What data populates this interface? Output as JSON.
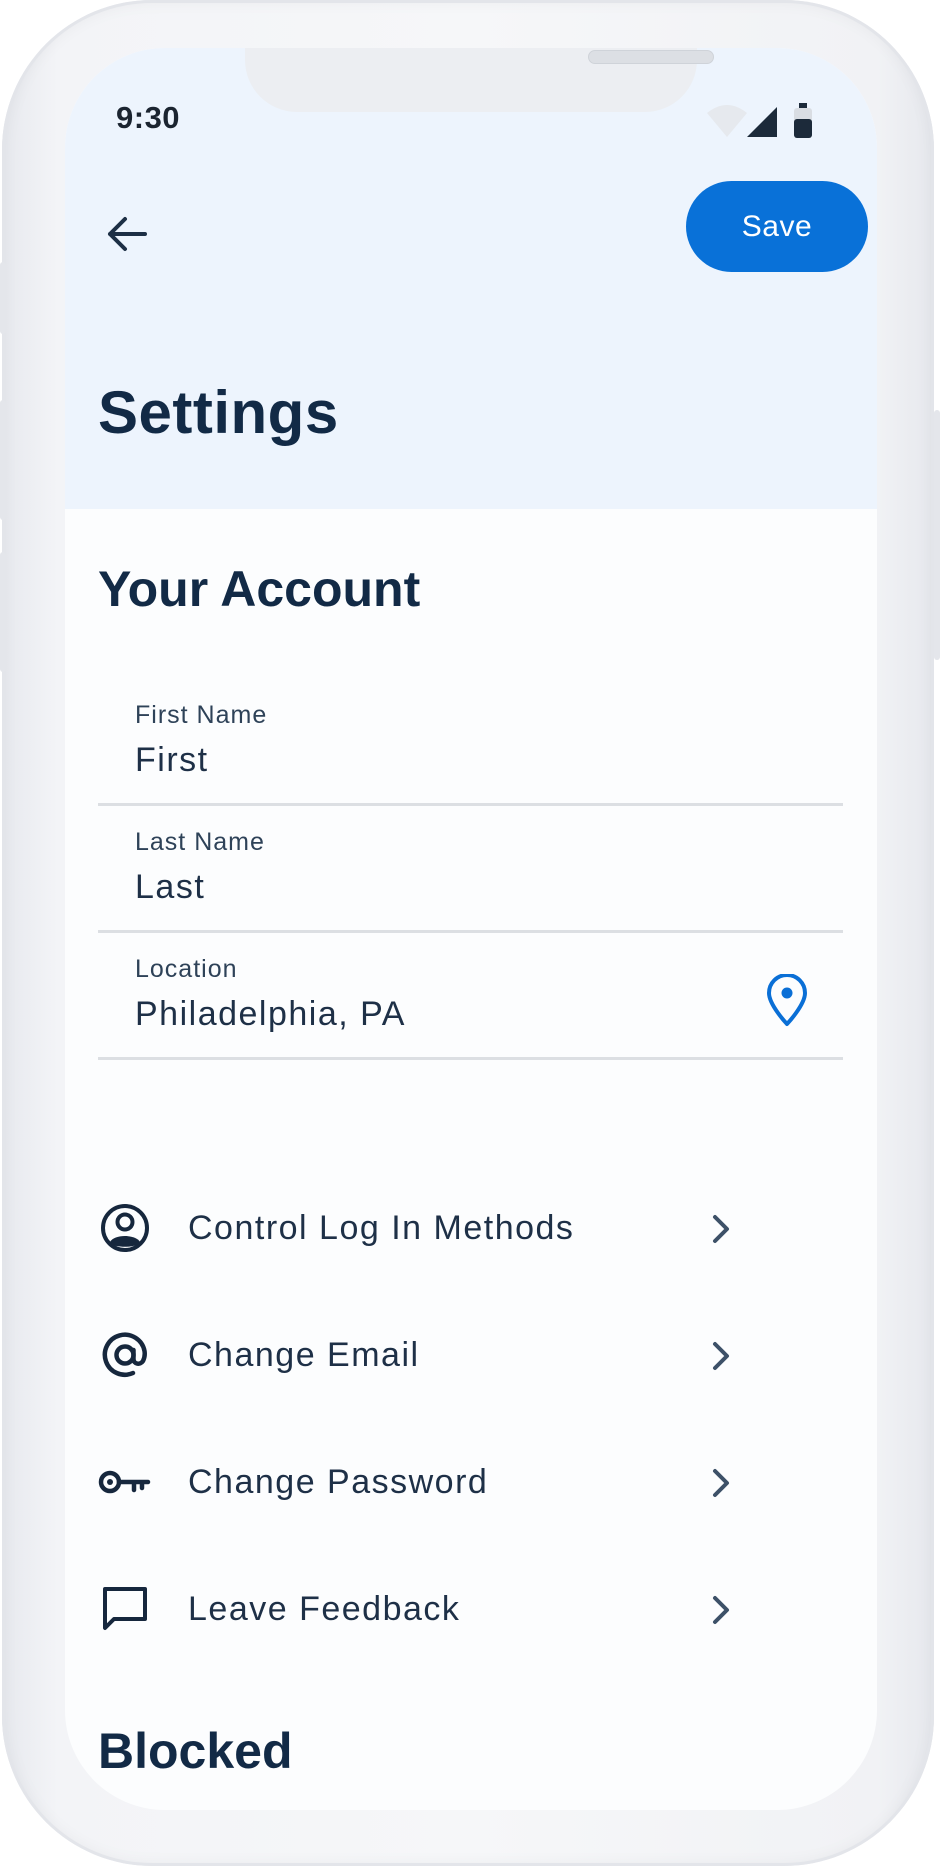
{
  "status_bar": {
    "time": "9:30",
    "icons": [
      "wifi-icon",
      "cellular-signal-icon",
      "battery-icon"
    ]
  },
  "toolbar": {
    "back_icon": "arrow-left-icon",
    "save_label": "Save"
  },
  "page": {
    "title": "Settings"
  },
  "account": {
    "title": "Your Account",
    "fields": {
      "first_name": {
        "label": "First Name",
        "value": "First"
      },
      "last_name": {
        "label": "Last Name",
        "value": "Last"
      },
      "location": {
        "label": "Location",
        "value": "Philadelphia, PA",
        "icon": "location-pin-icon"
      }
    }
  },
  "menu": {
    "items": [
      {
        "label": "Control Log In Methods",
        "icon": "user-circle-icon"
      },
      {
        "label": "Change Email",
        "icon": "at-sign-icon"
      },
      {
        "label": "Change Password",
        "icon": "key-icon"
      },
      {
        "label": "Leave Feedback",
        "icon": "chat-bubble-icon"
      }
    ],
    "chevron_icon": "chevron-right-icon"
  },
  "blocked": {
    "title": "Blocked"
  },
  "colors": {
    "accent": "#0971d8",
    "heading": "#122a46",
    "header_background": "#edf4fd",
    "divider": "#dcdfe3"
  }
}
